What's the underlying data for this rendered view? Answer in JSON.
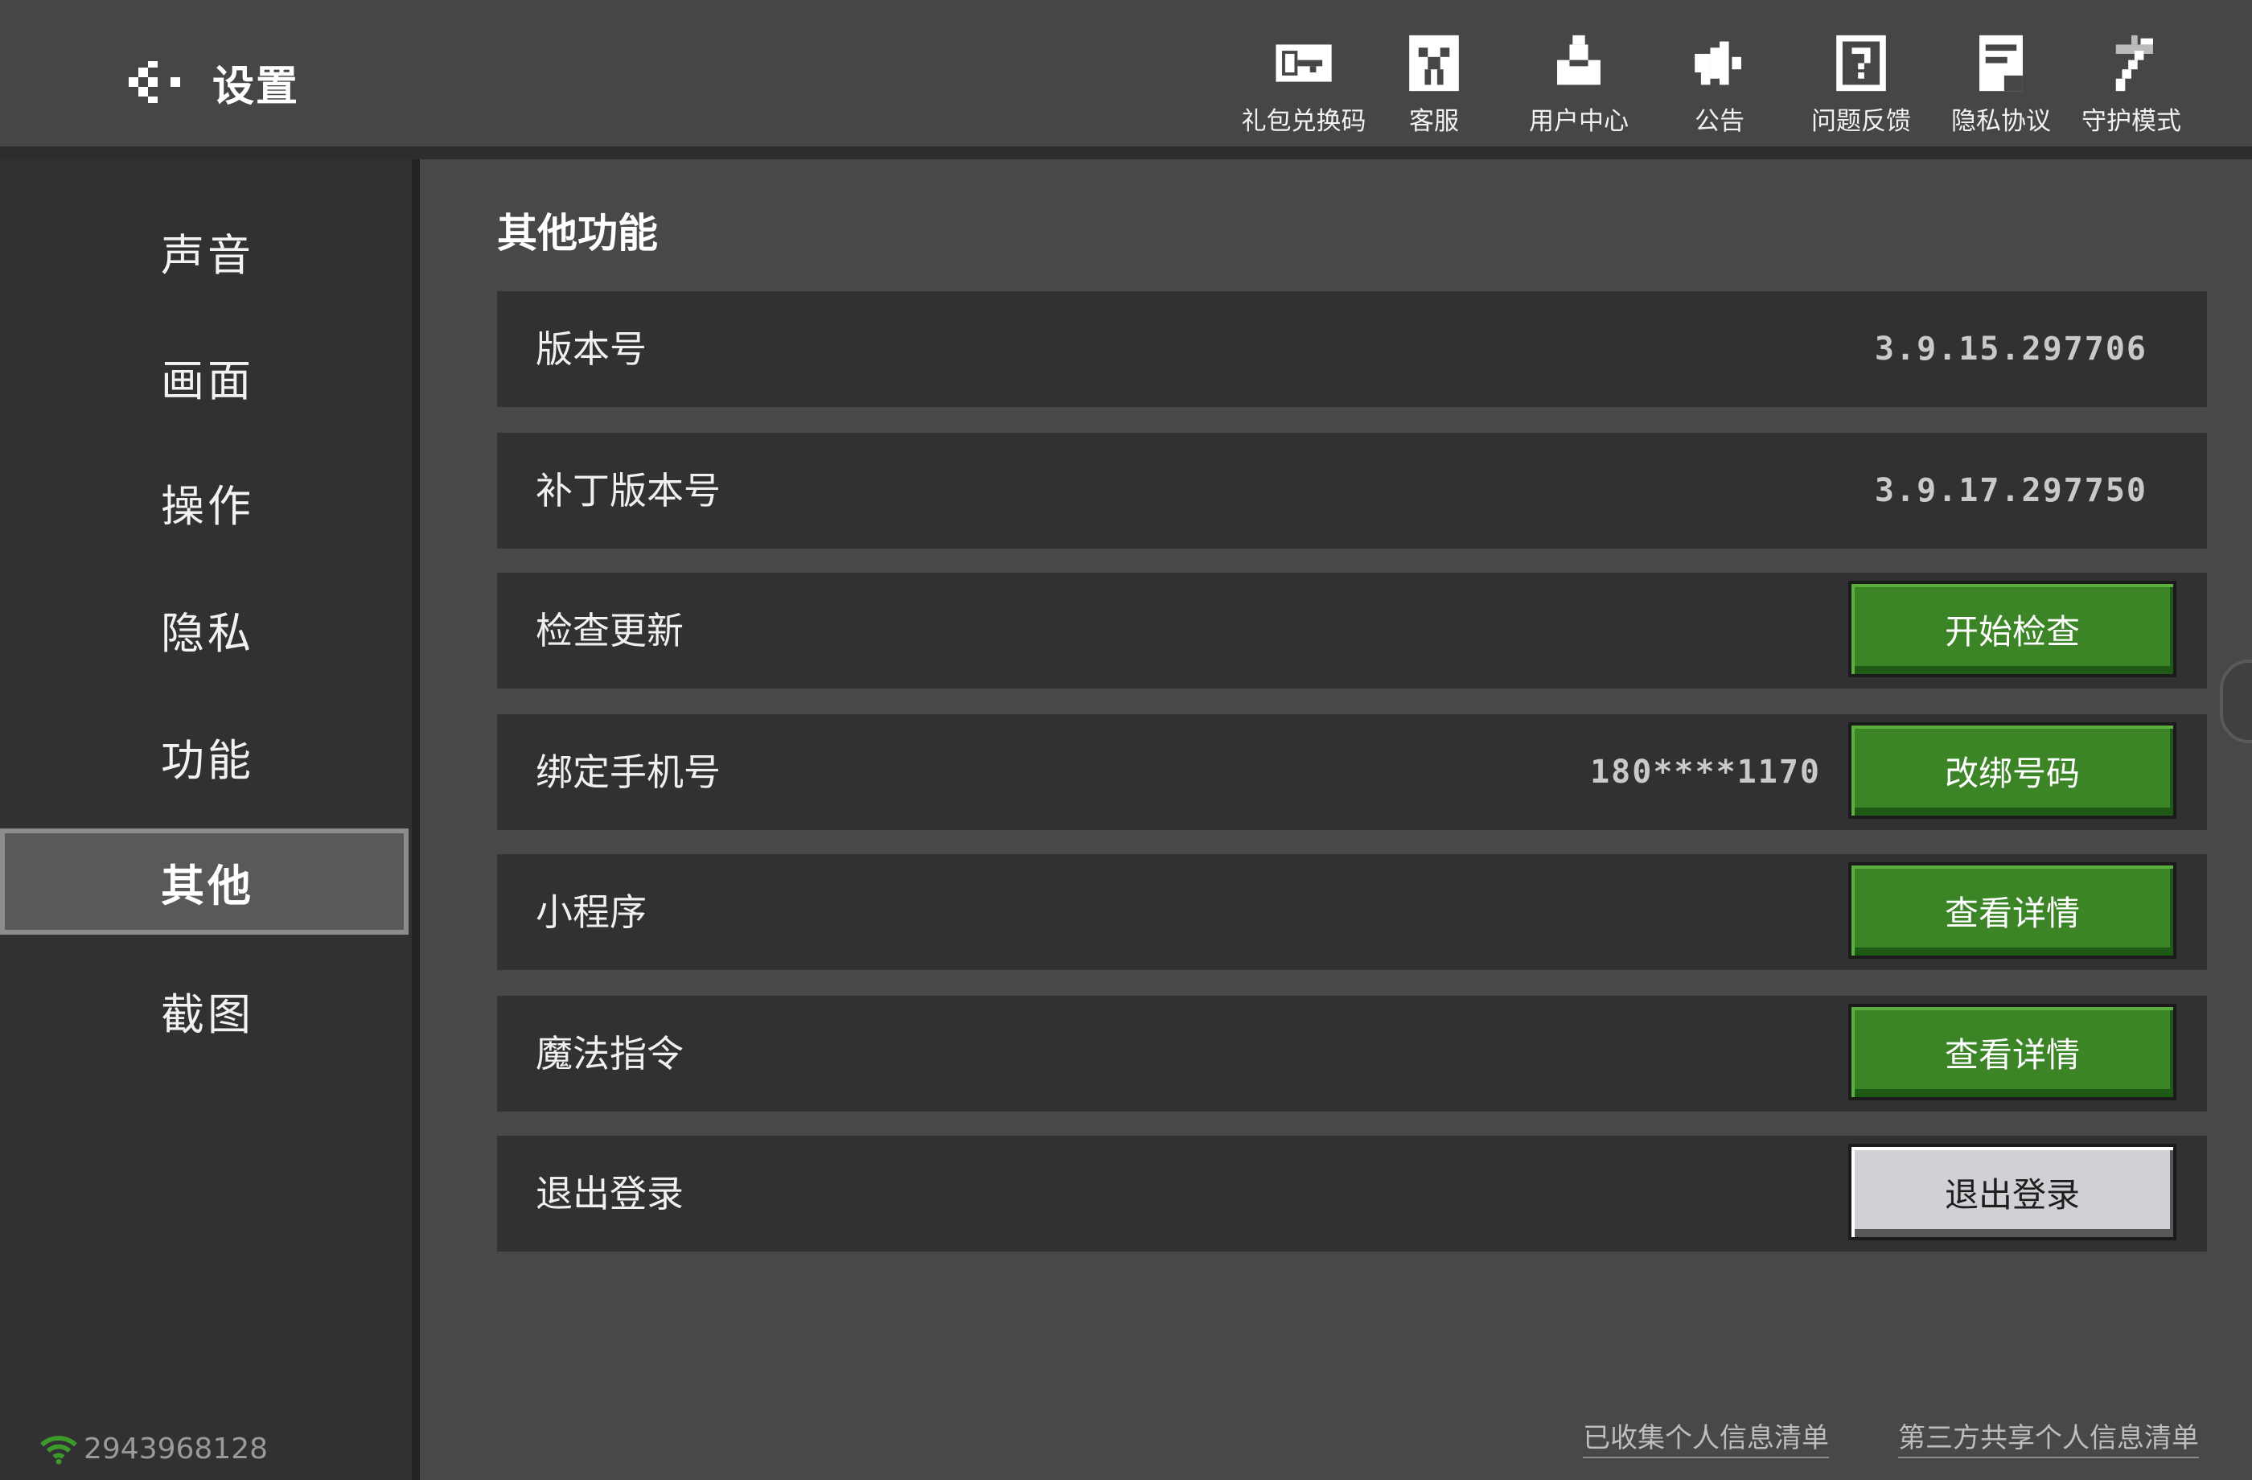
{
  "header": {
    "title": "设置",
    "back_icon": "back-arrow-icon",
    "tools": [
      {
        "label": "礼包兑换码",
        "icon": "key-icon"
      },
      {
        "label": "客服",
        "icon": "customer-service-icon"
      },
      {
        "label": "用户中心",
        "icon": "user-center-icon"
      },
      {
        "label": "公告",
        "icon": "megaphone-icon"
      },
      {
        "label": "问题反馈",
        "icon": "question-icon"
      },
      {
        "label": "隐私协议",
        "icon": "document-icon"
      },
      {
        "label": "守护模式",
        "icon": "guard-icon"
      }
    ]
  },
  "sidebar": {
    "items": [
      {
        "label": "声音"
      },
      {
        "label": "画面"
      },
      {
        "label": "操作"
      },
      {
        "label": "隐私"
      },
      {
        "label": "功能"
      },
      {
        "label": "其他",
        "active": true
      },
      {
        "label": "截图"
      }
    ],
    "network_id": "2943968128",
    "network_icon": "wifi-icon",
    "network_color": "#3c9a2a"
  },
  "content": {
    "section_title": "其他功能",
    "rows": [
      {
        "label": "版本号",
        "value": "3.9.15.297706"
      },
      {
        "label": "补丁版本号",
        "value": "3.9.17.297750"
      },
      {
        "label": "检查更新",
        "button": "开始检查"
      },
      {
        "label": "绑定手机号",
        "value": "180****1170",
        "button": "改绑号码"
      },
      {
        "label": "小程序",
        "button": "查看详情"
      },
      {
        "label": "魔法指令",
        "button": "查看详情"
      },
      {
        "label": "退出登录",
        "button": "退出登录"
      }
    ],
    "footer_links": [
      "已收集个人信息清单",
      "第三方共享个人信息清单"
    ]
  },
  "colors": {
    "accent_green": "#3c8527",
    "background": "#48484a",
    "sidebar": "#313133"
  }
}
